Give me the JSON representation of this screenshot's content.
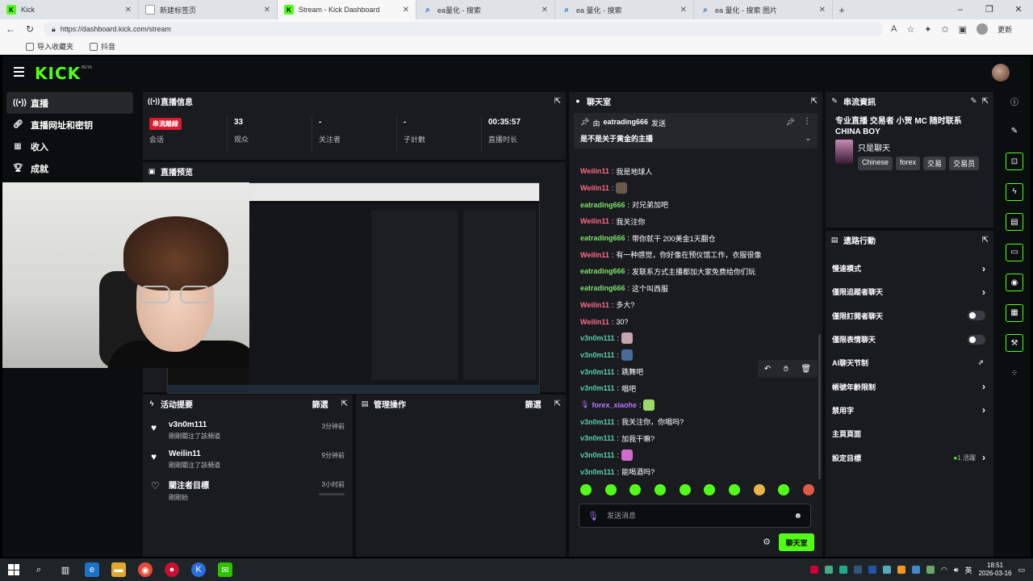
{
  "browser": {
    "tabs": [
      {
        "title": "Kick",
        "icon": "kick-icon",
        "active": false
      },
      {
        "title": "新建标签页",
        "icon": "page-icon",
        "active": false
      },
      {
        "title": "Stream - Kick Dashboard",
        "icon": "kick-icon",
        "active": true
      },
      {
        "title": "ea量化 - 搜索",
        "icon": "search-icon",
        "active": false
      },
      {
        "title": "ea 量化 - 搜索",
        "icon": "search-icon",
        "active": false
      },
      {
        "title": "ea 量化 - 搜索 图片",
        "icon": "search-icon",
        "active": false
      }
    ],
    "new_tab": "+",
    "url": "https://dashboard.kick.com/stream",
    "profile_label": "更新",
    "bookmarks": [
      {
        "label": "导入收藏夹"
      },
      {
        "label": "抖音"
      }
    ]
  },
  "app": {
    "logo": "KICK",
    "beta": "BETA",
    "brand_color": "#53fc18"
  },
  "sidebar": {
    "items": [
      {
        "label": "直播",
        "icon": "broadcast-icon",
        "active": true
      },
      {
        "label": "直播网址和密钥",
        "icon": "link-icon",
        "active": false
      },
      {
        "label": "收入",
        "icon": "chart-icon",
        "active": false
      },
      {
        "label": "成就",
        "icon": "trophy-icon",
        "active": false
      }
    ]
  },
  "stream_info": {
    "title": "直播信息",
    "stats": [
      {
        "value": "",
        "badge": "串流離線",
        "label": "会话"
      },
      {
        "value": "33",
        "label": "观众"
      },
      {
        "value": "-",
        "label": "关注者"
      },
      {
        "value": "-",
        "label": "子計數"
      },
      {
        "value": "00:35:57",
        "label": "直播时长"
      }
    ]
  },
  "preview": {
    "title": "直播预览"
  },
  "activity": {
    "title": "活动提要",
    "filter": "篩選",
    "items": [
      {
        "name": "v3n0m111",
        "sub": "剛剛關注了該頻道",
        "time": "3分钟前",
        "icon": "heart-filled-icon"
      },
      {
        "name": "Weilin11",
        "sub": "剛剛關注了該頻道",
        "time": "9分钟前",
        "icon": "heart-filled-icon"
      },
      {
        "name": "關注者目標",
        "sub": "剛剛始",
        "time": "3小时前",
        "icon": "heart-outline-icon"
      }
    ]
  },
  "mod_actions": {
    "title": "管理操作",
    "filter": "篩選"
  },
  "chat": {
    "title": "聊天室",
    "pinned": {
      "by": "由",
      "user": "eatrading666",
      "action": "发送",
      "text": "是不是关于黄金的主播"
    },
    "messages": [
      {
        "user": "Weilin11",
        "color": "#ff6b8a",
        "text": "我是地球人"
      },
      {
        "user": "Weilin11",
        "color": "#ff6b8a",
        "text": "",
        "emote": "#6a5a4a"
      },
      {
        "user": "eatrading666",
        "color": "#7ee06a",
        "text": "对兄弟加吧"
      },
      {
        "user": "Weilin11",
        "color": "#ff6b8a",
        "text": "我关注你"
      },
      {
        "user": "eatrading666",
        "color": "#7ee06a",
        "text": "带你就干 200美金1天翻仓"
      },
      {
        "user": "Weilin11",
        "color": "#ff6b8a",
        "text": "有一种感觉，你好像在预仪馆工作，衣服很像"
      },
      {
        "user": "eatrading666",
        "color": "#7ee06a",
        "text": "发联系方式主播都加大家免费给你们玩"
      },
      {
        "user": "eatrading666",
        "color": "#7ee06a",
        "text": "这个叫西服"
      },
      {
        "user": "Weilin11",
        "color": "#ff6b8a",
        "text": "多大?"
      },
      {
        "user": "Weilin11",
        "color": "#ff6b8a",
        "text": "30?"
      },
      {
        "user": "v3n0m111",
        "color": "#5ad0a8",
        "text": "",
        "emote": "#c7a6b0"
      },
      {
        "user": "v3n0m111",
        "color": "#5ad0a8",
        "text": "",
        "emote": "#4a6a9a"
      },
      {
        "user": "v3n0m111",
        "color": "#5ad0a8",
        "text": "跳舞吧"
      },
      {
        "user": "v3n0m111",
        "color": "#5ad0a8",
        "text": "唱吧"
      },
      {
        "user": "forex_xiaohe",
        "color": "#b57bff",
        "text": "",
        "emote": "#9ad96a",
        "mic": true
      },
      {
        "user": "v3n0m111",
        "color": "#5ad0a8",
        "text": "我关注你，你唱吗?"
      },
      {
        "user": "v3n0m111",
        "color": "#5ad0a8",
        "text": "加我干嘛?"
      },
      {
        "user": "v3n0m111",
        "color": "#5ad0a8",
        "text": "",
        "emote": "#d36ad0"
      },
      {
        "user": "v3n0m111",
        "color": "#5ad0a8",
        "text": "能喝酒吗?"
      }
    ],
    "input_placeholder": "发送消息",
    "send_label": "聊天室"
  },
  "stream_details": {
    "title": "串流資訊",
    "stream_title": "专业直播 交易者 小贺 MC 随时联系 CHINA BOY",
    "category": "只是聊天",
    "tags": [
      "Chinese",
      "forex",
      "交易",
      "交易员"
    ]
  },
  "quick_actions": {
    "title": "遗路行動",
    "items": [
      {
        "label": "慢速模式",
        "control": "chevron"
      },
      {
        "label": "僅限追蹤者聊天",
        "control": "chevron"
      },
      {
        "label": "僅限訂閱者聊天",
        "control": "toggle"
      },
      {
        "label": "僅限表情聊天",
        "control": "toggle"
      },
      {
        "label": "AI聊天节制",
        "control": "external"
      },
      {
        "label": "帳號年齡限制",
        "control": "chevron"
      },
      {
        "label": "禁用字",
        "control": "chevron"
      },
      {
        "label": "主頁頁面",
        "control": "none"
      },
      {
        "label": "設定目標",
        "control": "chevron",
        "goal": "1 活躍"
      }
    ]
  },
  "taskbar": {
    "time": "18:51",
    "date": "2026-03-16",
    "lang": "英"
  }
}
